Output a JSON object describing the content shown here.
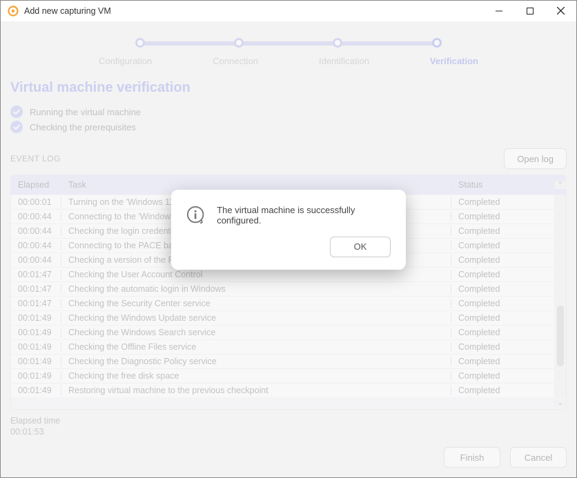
{
  "titlebar": {
    "title": "Add new capturing VM"
  },
  "stepper": {
    "steps": [
      "Configuration",
      "Connection",
      "Identification",
      "Verification"
    ],
    "active_index": 3
  },
  "section_title": "Virtual machine verification",
  "checks": [
    "Running the virtual machine",
    "Checking the prerequisites"
  ],
  "log": {
    "label": "EVENT LOG",
    "open_log_btn": "Open log",
    "columns": {
      "elapsed": "Elapsed",
      "task": "Task",
      "status": "Status"
    },
    "rows": [
      {
        "elapsed": "00:00:01",
        "task": "Turning on the 'Windows 11' virtual machine",
        "status": "Completed"
      },
      {
        "elapsed": "00:00:44",
        "task": "Connecting to the 'Windows 11' virtual machine",
        "status": "Completed"
      },
      {
        "elapsed": "00:00:44",
        "task": "Checking the login credentials",
        "status": "Completed"
      },
      {
        "elapsed": "00:00:44",
        "task": "Connecting to the PACE backend service",
        "status": "Completed"
      },
      {
        "elapsed": "00:00:44",
        "task": "Checking a version of the PACE backend service",
        "status": "Completed"
      },
      {
        "elapsed": "00:01:47",
        "task": "Checking the User Account Control",
        "status": "Completed"
      },
      {
        "elapsed": "00:01:47",
        "task": "Checking the automatic login in Windows",
        "status": "Completed"
      },
      {
        "elapsed": "00:01:47",
        "task": "Checking the Security Center service",
        "status": "Completed"
      },
      {
        "elapsed": "00:01:49",
        "task": "Checking the Windows Update service",
        "status": "Completed"
      },
      {
        "elapsed": "00:01:49",
        "task": "Checking the Windows Search service",
        "status": "Completed"
      },
      {
        "elapsed": "00:01:49",
        "task": "Checking the Offline Files service",
        "status": "Completed"
      },
      {
        "elapsed": "00:01:49",
        "task": "Checking the Diagnostic Policy service",
        "status": "Completed"
      },
      {
        "elapsed": "00:01:49",
        "task": "Checking the free disk space",
        "status": "Completed"
      },
      {
        "elapsed": "00:01:49",
        "task": "Restoring virtual machine to the previous checkpoint",
        "status": "Completed"
      }
    ]
  },
  "elapsed": {
    "label": "Elapsed time",
    "value": "00:01:53"
  },
  "footer": {
    "finish": "Finish",
    "cancel": "Cancel"
  },
  "dialog": {
    "text": "The virtual machine is successfully configured.",
    "ok": "OK"
  }
}
